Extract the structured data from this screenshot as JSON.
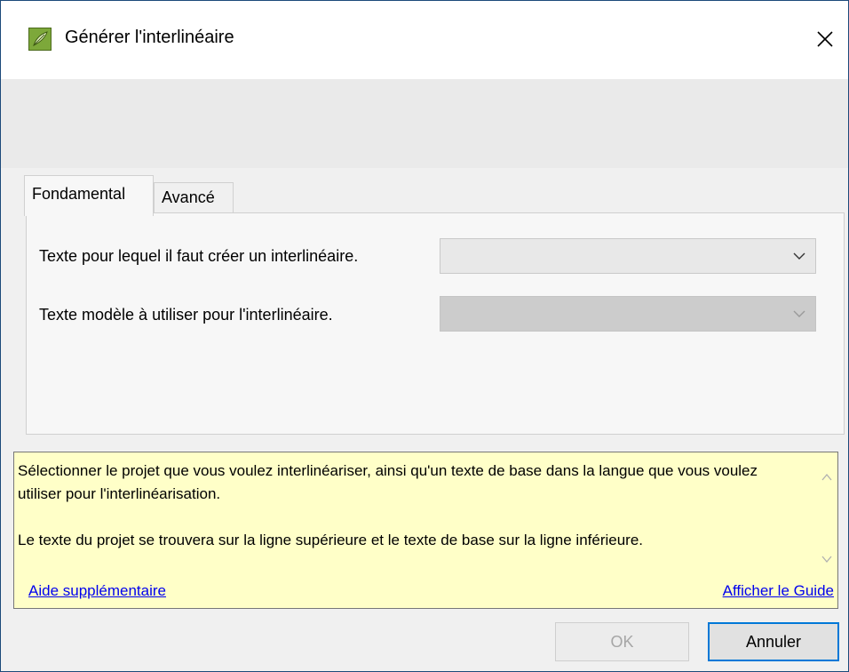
{
  "window": {
    "title": "Générer l'interlinéaire",
    "icon": "app-leaf-icon",
    "close_glyph": "✕"
  },
  "tabs": [
    {
      "label": "Fondamental",
      "active": true
    },
    {
      "label": "Avancé",
      "active": false
    }
  ],
  "fields": {
    "source_text": {
      "label": "Texte pour lequel il faut créer un interlinéaire.",
      "value": "",
      "enabled": true
    },
    "model_text": {
      "label": "Texte modèle à utiliser pour l'interlinéaire.",
      "value": "",
      "enabled": false
    }
  },
  "help": {
    "paragraph1": "Sélectionner le projet que vous voulez interlinéariser, ainsi qu'un texte de base dans la langue que vous voulez utiliser pour l'interlinéarisation.",
    "paragraph2": "Le texte du projet se trouvera sur la ligne supérieure et le texte de base sur la ligne inférieure.",
    "more_help_link": "Aide supplémentaire",
    "show_guide_link": "Afficher le Guide",
    "background": "#ffffc8"
  },
  "buttons": {
    "ok": {
      "label": "OK",
      "enabled": false
    },
    "cancel": {
      "label": "Annuler",
      "enabled": true
    }
  },
  "colors": {
    "accent": "#0078d7",
    "link": "#0000ee"
  }
}
